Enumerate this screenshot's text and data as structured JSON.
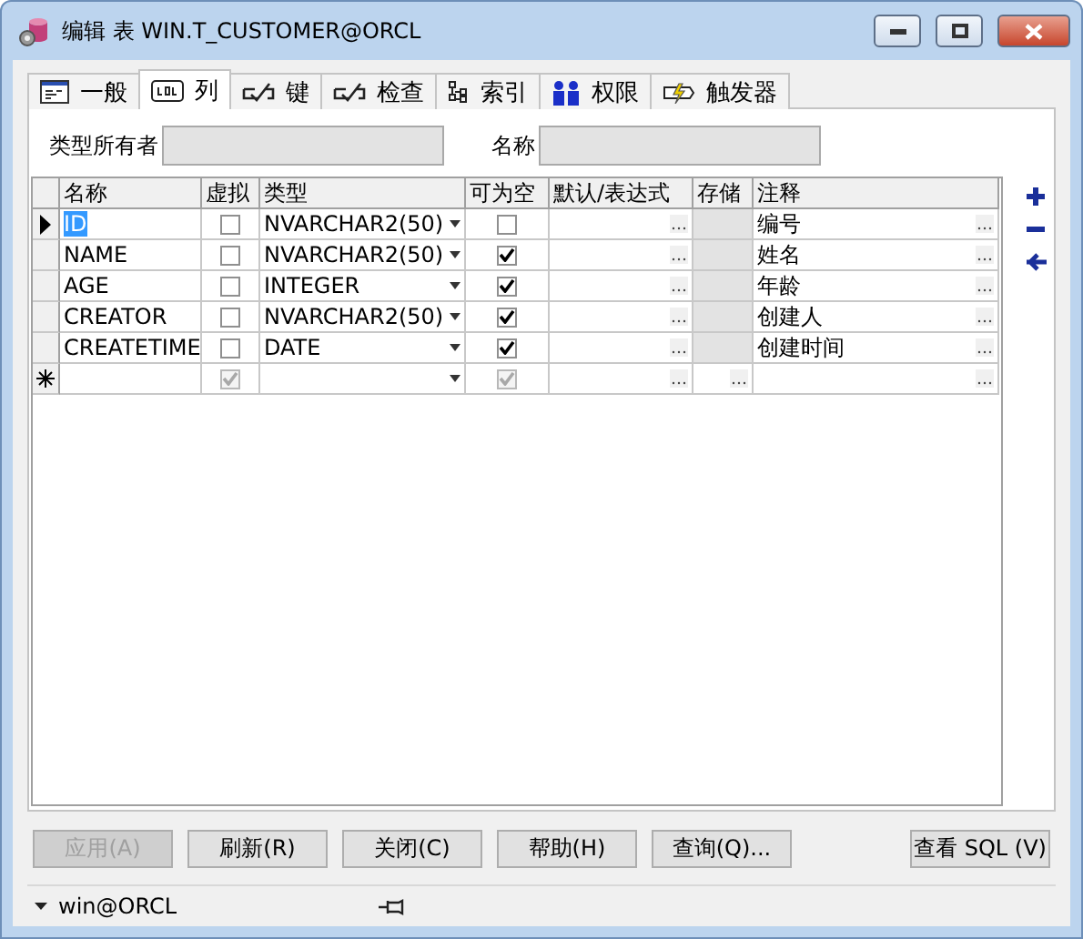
{
  "window": {
    "title": "编辑 表 WIN.T_CUSTOMER@ORCL"
  },
  "tabs": [
    {
      "label": "一般",
      "selected": false
    },
    {
      "label": "列",
      "selected": true
    },
    {
      "label": "键",
      "selected": false
    },
    {
      "label": "检查",
      "selected": false
    },
    {
      "label": "索引",
      "selected": false
    },
    {
      "label": "权限",
      "selected": false
    },
    {
      "label": "触发器",
      "selected": false
    }
  ],
  "fields": [
    {
      "label": "类型所有者",
      "value_disabled": true
    },
    {
      "label": "名称",
      "value_disabled": true
    }
  ],
  "columns": [
    "名称",
    "虚拟",
    "类型",
    "可为空",
    "默认/表达式",
    "存储",
    "注释"
  ],
  "rows": [
    {
      "kind": "row",
      "current": true,
      "name": "ID",
      "virtual": false,
      "type": "NVARCHAR2(50)",
      "nullable": false,
      "comment": "编号"
    },
    {
      "kind": "row",
      "current": false,
      "name": "NAME",
      "virtual": false,
      "type": "NVARCHAR2(50)",
      "nullable": true,
      "comment": "姓名"
    },
    {
      "kind": "row",
      "current": false,
      "name": "AGE",
      "virtual": false,
      "type": "INTEGER",
      "nullable": true,
      "comment": "年龄"
    },
    {
      "kind": "row",
      "current": false,
      "name": "CREATOR",
      "virtual": false,
      "type": "NVARCHAR2(50)",
      "nullable": true,
      "comment": "创建人"
    },
    {
      "kind": "row",
      "current": false,
      "name": "CREATETIME",
      "virtual": false,
      "type": "DATE",
      "nullable": true,
      "comment": "创建时间"
    },
    {
      "kind": "new",
      "current": false,
      "name": "",
      "virtual": true,
      "type": "",
      "nullable": true,
      "comment": ""
    }
  ],
  "buttons": [
    {
      "label": "应用(A)",
      "disabled": true
    },
    {
      "label": "刷新(R)",
      "disabled": false
    },
    {
      "label": "关闭(C)",
      "disabled": false
    },
    {
      "label": "帮助(H)",
      "disabled": false
    },
    {
      "label": "查询(Q)...",
      "disabled": false
    }
  ],
  "sql_button": {
    "label": "查看 SQL (V)",
    "disabled": false
  },
  "status_bar": {
    "connection": "win@ORCL"
  }
}
